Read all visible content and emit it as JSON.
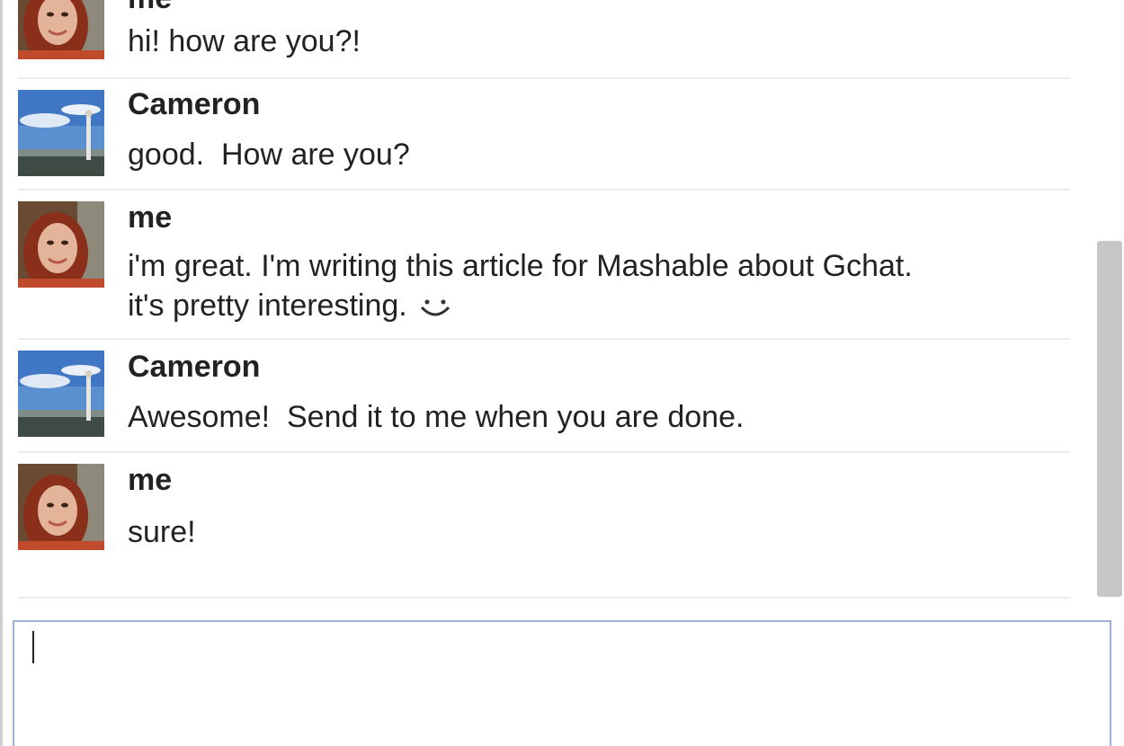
{
  "messages": [
    {
      "sender": "me",
      "text": "hi! how are you?!",
      "avatar": "woman-photo"
    },
    {
      "sender": "Cameron",
      "text": "good.  How are you?",
      "avatar": "landscape-photo"
    },
    {
      "sender": "me",
      "text": "i'm great. I'm writing this article for Mashable about Gchat.\nit's pretty interesting.",
      "avatar": "woman-photo",
      "emoji": "smiley-icon"
    },
    {
      "sender": "Cameron",
      "text": "Awesome!  Send it to me when you are done.",
      "avatar": "landscape-photo"
    },
    {
      "sender": "me",
      "text": "sure!",
      "avatar": "woman-photo"
    }
  ],
  "input": {
    "value": "",
    "placeholder": ""
  },
  "colors": {
    "input_border": "#9fb2d6",
    "scrollbar_thumb": "#c7c7c7",
    "divider": "#ececec"
  }
}
